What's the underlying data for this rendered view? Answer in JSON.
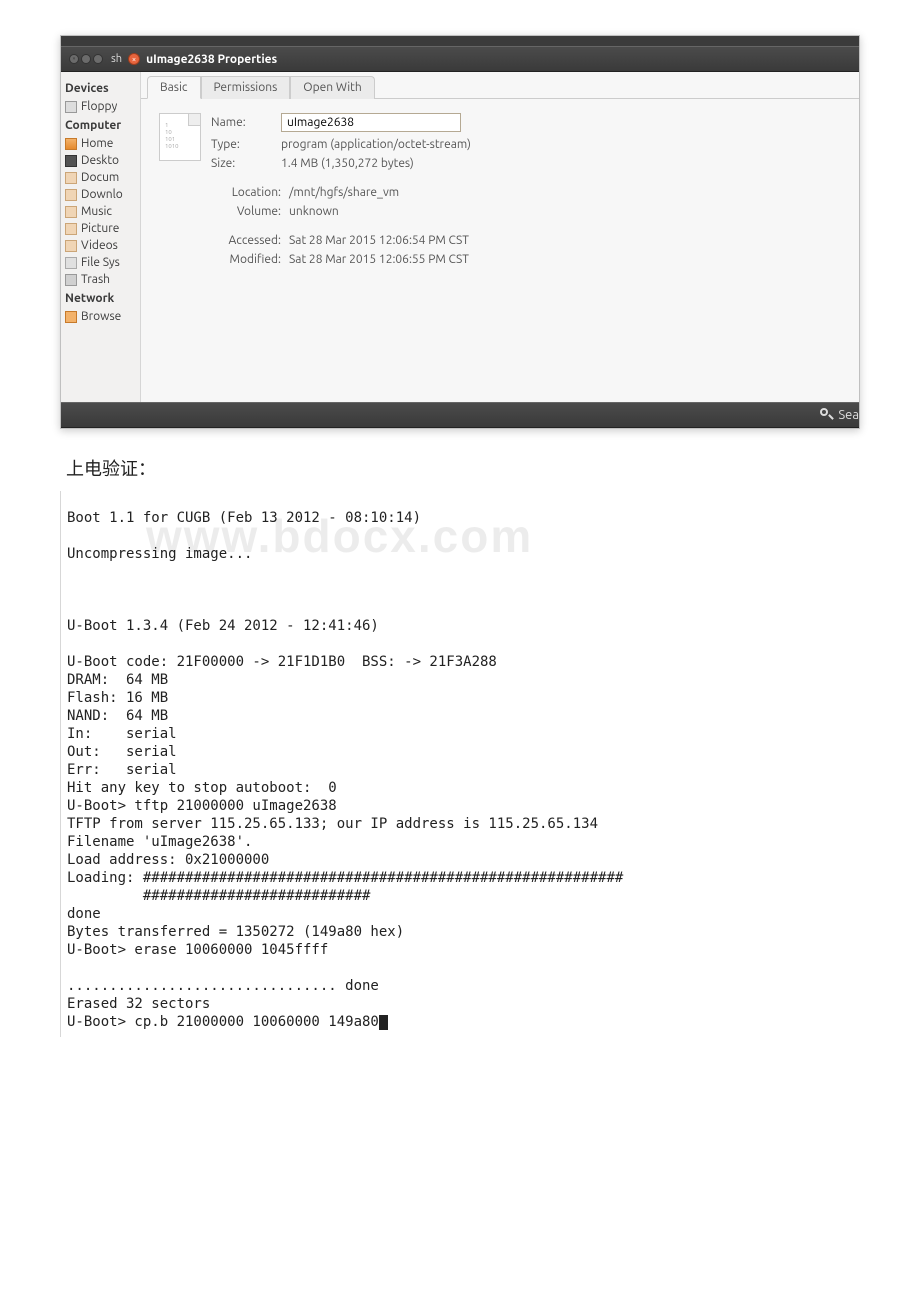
{
  "window": {
    "dialog_title": "uImage2638 Properties",
    "sh": "sh",
    "search_label": "Sea"
  },
  "sidebar": {
    "heads": {
      "devices": "Devices",
      "computer": "Computer",
      "network": "Network"
    },
    "items": {
      "floppy": "Floppy",
      "home": "Home",
      "deskto": "Deskto",
      "docum": "Docum",
      "downlo": "Downlo",
      "music": "Music",
      "picture": "Picture",
      "videos": "Videos",
      "filesys": "File Sys",
      "trash": "Trash",
      "browse": "Browse"
    }
  },
  "tabs": {
    "basic": "Basic",
    "perm": "Permissions",
    "open": "Open With"
  },
  "props": {
    "labels": {
      "name": "Name:",
      "type": "Type:",
      "size": "Size:",
      "location": "Location:",
      "volume": "Volume:",
      "accessed": "Accessed:",
      "modified": "Modified:"
    },
    "name_value": "uImage2638",
    "type": "program (application/octet-stream)",
    "size": "1.4 MB (1,350,272 bytes)",
    "location": "/mnt/hgfs/share_vm",
    "volume": "unknown",
    "accessed": "Sat 28 Mar 2015 12:06:54 PM CST",
    "modified": "Sat 28 Mar 2015 12:06:55 PM CST"
  },
  "heading": "上电验证：",
  "watermark": "www.bdocx.com",
  "terminal": "\nBoot 1.1 for CUGB (Feb 13 2012 - 08:10:14)\n\nUncompressing image...\n\n\n\nU-Boot 1.3.4 (Feb 24 2012 - 12:41:46)\n\nU-Boot code: 21F00000 -> 21F1D1B0  BSS: -> 21F3A288\nDRAM:  64 MB\nFlash: 16 MB\nNAND:  64 MB\nIn:    serial\nOut:   serial\nErr:   serial\nHit any key to stop autoboot:  0\nU-Boot> tftp 21000000 uImage2638\nTFTP from server 115.25.65.133; our IP address is 115.25.65.134\nFilename 'uImage2638'.\nLoad address: 0x21000000\nLoading: #########################################################\n         ###########################\ndone\nBytes transferred = 1350272 (149a80 hex)\nU-Boot> erase 10060000 1045ffff\n\n................................ done\nErased 32 sectors\nU-Boot> cp.b 21000000 10060000 149a80"
}
